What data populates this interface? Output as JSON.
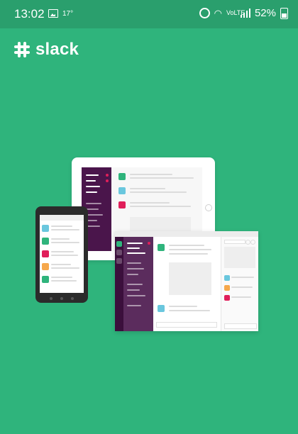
{
  "statusbar": {
    "time": "13:02",
    "temperature": "17°",
    "network": "VoLTE",
    "battery": "52%",
    "icons": [
      "gallery-icon",
      "alarm-icon",
      "wifi-icon",
      "volte-icon",
      "signal-icon",
      "battery-icon"
    ]
  },
  "app": {
    "brand_name": "slack",
    "logo_icon": "slack-logo-icon"
  },
  "theme": {
    "background": "#2fb47c",
    "statusbar": "#2a9f6d",
    "aubergine": "#4a154b",
    "accent_green": "#2fb47c",
    "accent_blue": "#6ac7de",
    "accent_red": "#e01e5a",
    "accent_orange": "#f6a84c"
  },
  "illustration": {
    "name": "devices-illustration",
    "devices": [
      "tablet",
      "phone",
      "desktop"
    ]
  }
}
